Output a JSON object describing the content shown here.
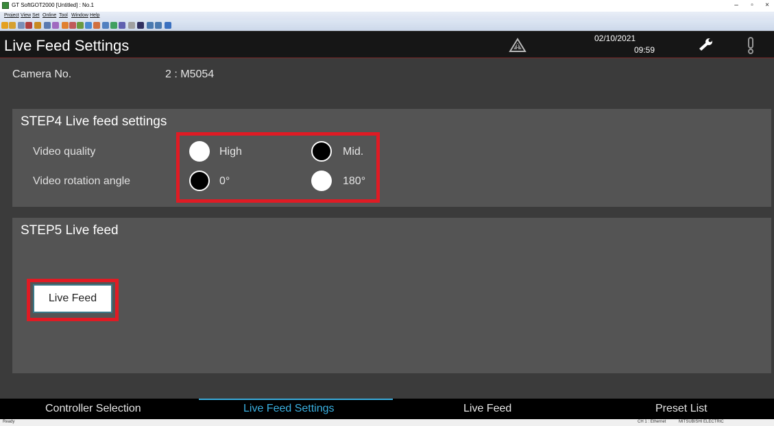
{
  "window": {
    "title": "GT SoftGOT2000 [Untitled] : No.1",
    "minimize": "–",
    "maximize": "▫",
    "close": "×"
  },
  "menu": [
    "Project",
    "View",
    "Set",
    "Online",
    "Tool",
    "Window",
    "Help"
  ],
  "header": {
    "title": "Live Feed Settings",
    "date": "02/10/2021",
    "time": "09:59"
  },
  "camera": {
    "label": "Camera No.",
    "value": "2 : M5054"
  },
  "step4": {
    "title": "STEP4 Live feed settings",
    "video_quality": {
      "label": "Video quality",
      "options": [
        "High",
        "Mid."
      ],
      "selected": "Mid."
    },
    "video_rotation": {
      "label": "Video rotation angle",
      "options": [
        "0°",
        "180°"
      ],
      "selected": "0°"
    }
  },
  "step5": {
    "title": "STEP5 Live feed",
    "button": "Live Feed"
  },
  "nav": {
    "tabs": [
      "Controller Selection",
      "Live Feed Settings",
      "Live Feed",
      "Preset List"
    ],
    "active": "Live Feed Settings"
  },
  "status": {
    "left": "Ready",
    "channel": "CH 1 : Ethernet",
    "vendor": "MITSUBISHI ELECTRIC"
  },
  "colors": {
    "highlight": "#e01b24",
    "accent": "#3ab0e0",
    "panel": "#545454"
  }
}
